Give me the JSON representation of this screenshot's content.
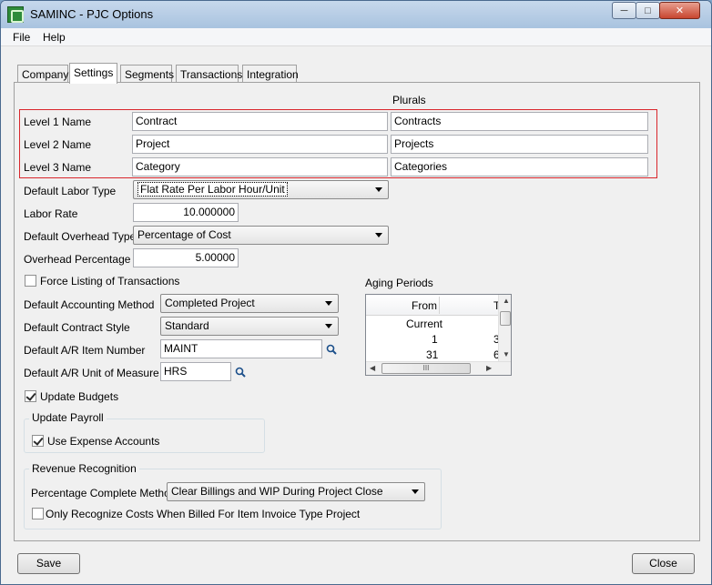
{
  "window": {
    "title": "SAMINC - PJC Options"
  },
  "menu": {
    "file": "File",
    "help": "Help"
  },
  "tabs": [
    {
      "label": "Company",
      "active": false
    },
    {
      "label": "Settings",
      "active": true
    },
    {
      "label": "Segments",
      "active": false
    },
    {
      "label": "Transactions",
      "active": false
    },
    {
      "label": "Integration",
      "active": false
    }
  ],
  "levels": {
    "plurals_header": "Plurals",
    "rows": [
      {
        "label": "Level 1 Name",
        "singular": "Contract",
        "plural": "Contracts"
      },
      {
        "label": "Level 2 Name",
        "singular": "Project",
        "plural": "Projects"
      },
      {
        "label": "Level 3 Name",
        "singular": "Category",
        "plural": "Categories"
      }
    ]
  },
  "settings": {
    "default_labor_type_label": "Default Labor Type",
    "default_labor_type_value": "Flat Rate Per Labor Hour/Unit",
    "labor_rate_label": "Labor Rate",
    "labor_rate_value": "10.000000",
    "default_overhead_type_label": "Default Overhead Type",
    "default_overhead_type_value": "Percentage of Cost",
    "overhead_percentage_label": "Overhead Percentage",
    "overhead_percentage_value": "5.00000",
    "force_listing_label": "Force Listing of Transactions",
    "force_listing_checked": false,
    "accounting_method_label": "Default Accounting Method",
    "accounting_method_value": "Completed Project",
    "contract_style_label": "Default Contract Style",
    "contract_style_value": "Standard",
    "ar_item_label": "Default A/R Item Number",
    "ar_item_value": "MAINT",
    "ar_uom_label": "Default A/R Unit of Measure",
    "ar_uom_value": "HRS",
    "update_budgets_label": "Update Budgets",
    "update_budgets_checked": true
  },
  "aging": {
    "label": "Aging Periods",
    "header_from": "From",
    "header_to": "T",
    "rows": [
      {
        "from": "Current",
        "to": ""
      },
      {
        "from": "1",
        "to": "3"
      },
      {
        "from": "31",
        "to": "6"
      }
    ],
    "hscroll_grip": "III"
  },
  "update_payroll": {
    "title": "Update Payroll",
    "use_expense_label": "Use Expense Accounts",
    "use_expense_checked": true
  },
  "revenue": {
    "title": "Revenue Recognition",
    "pct_complete_label": "Percentage Complete Method",
    "pct_complete_value": "Clear Billings and WIP During Project Close",
    "only_recognize_label": "Only Recognize Costs When Billed For Item Invoice Type Project",
    "only_recognize_checked": false
  },
  "buttons": {
    "save": "Save",
    "close": "Close"
  },
  "colors": {
    "highlight_border": "#d9262b",
    "titlebar": "#b7cde6"
  }
}
